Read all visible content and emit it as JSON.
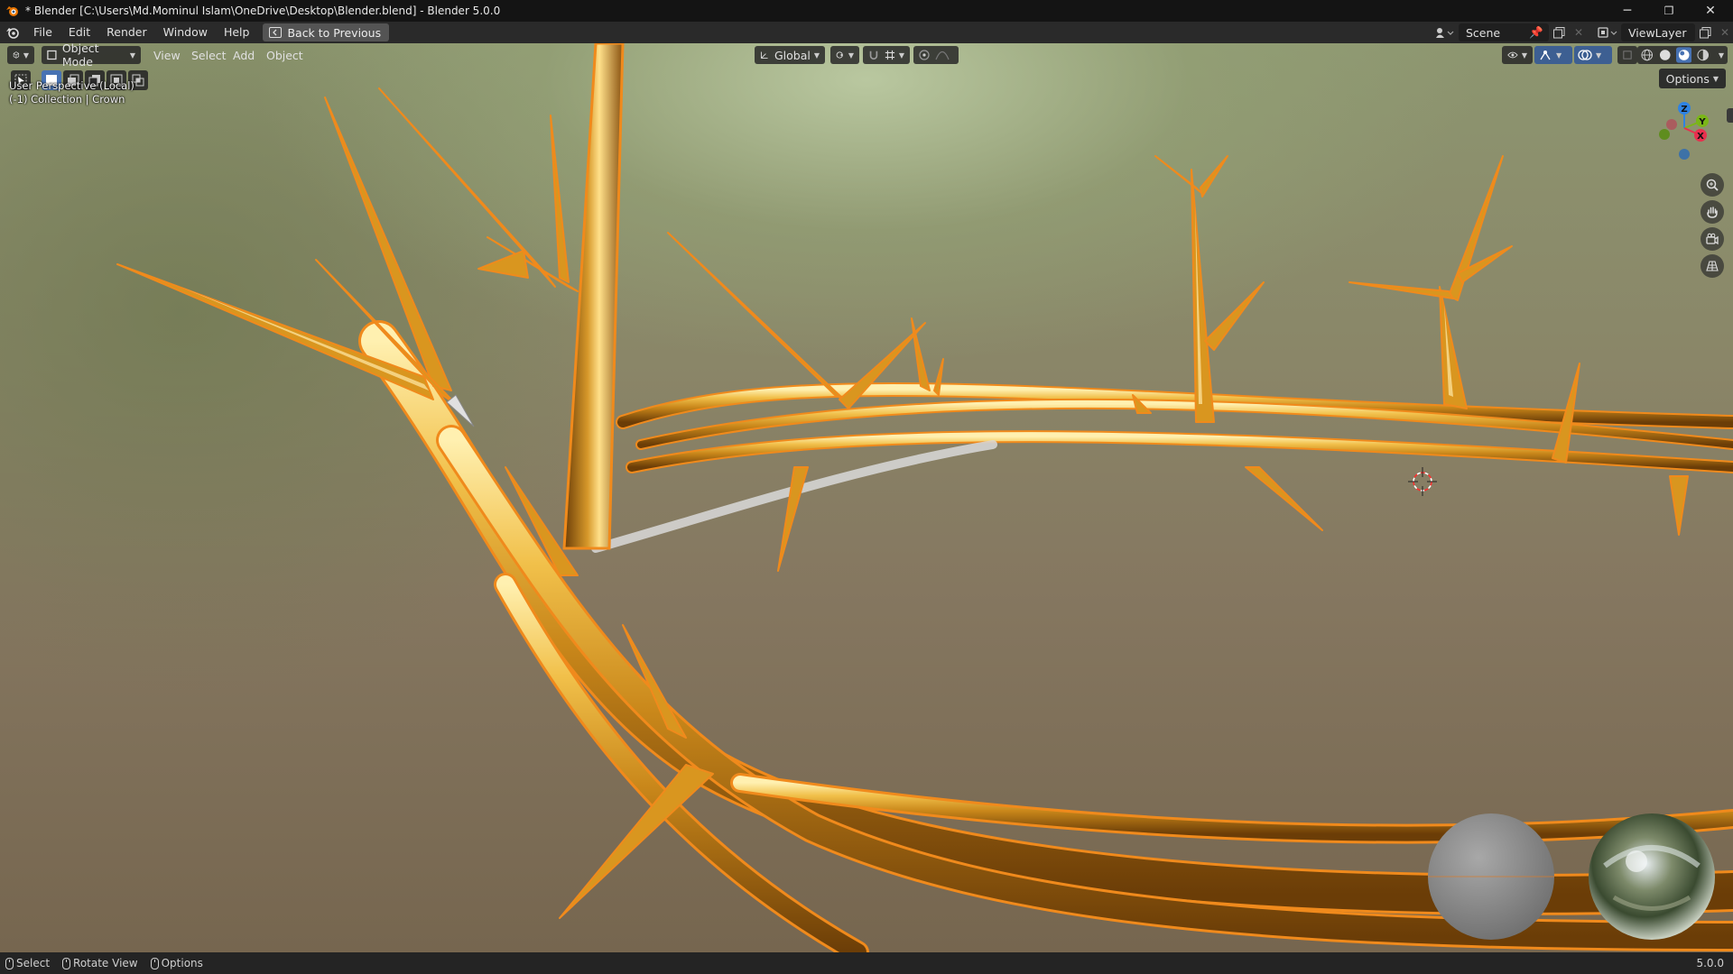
{
  "window": {
    "title": "* Blender [C:\\Users\\Md.Mominul Islam\\OneDrive\\Desktop\\Blender.blend] - Blender 5.0.0",
    "controls": {
      "minimize": "─",
      "restore": "❐",
      "close": "✕"
    }
  },
  "menubar": {
    "items": [
      "File",
      "Edit",
      "Render",
      "Window",
      "Help"
    ],
    "back_button": "Back to Previous",
    "scene_name": "Scene",
    "view_layer": "ViewLayer"
  },
  "viewport_header": {
    "mode": "Object Mode",
    "menus": [
      "View",
      "Select",
      "Add",
      "Object"
    ],
    "transform_orientation": "Global",
    "options_label": "Options"
  },
  "viewport_overlay": {
    "perspective": "User Perspective (Local)",
    "collection": "(-1) Collection | Crown"
  },
  "gizmo": {
    "z": "Z",
    "y": "Y",
    "x": "X"
  },
  "statusbar": {
    "items": [
      "Select",
      "Rotate View",
      "Options"
    ],
    "version": "5.0.0"
  },
  "colors": {
    "accent": "#4772b3",
    "gold": "#d9961f",
    "selection_outline": "#f08a1c",
    "axis_x": "#e8304e",
    "axis_y": "#7ab618",
    "axis_z": "#2f83e3"
  }
}
